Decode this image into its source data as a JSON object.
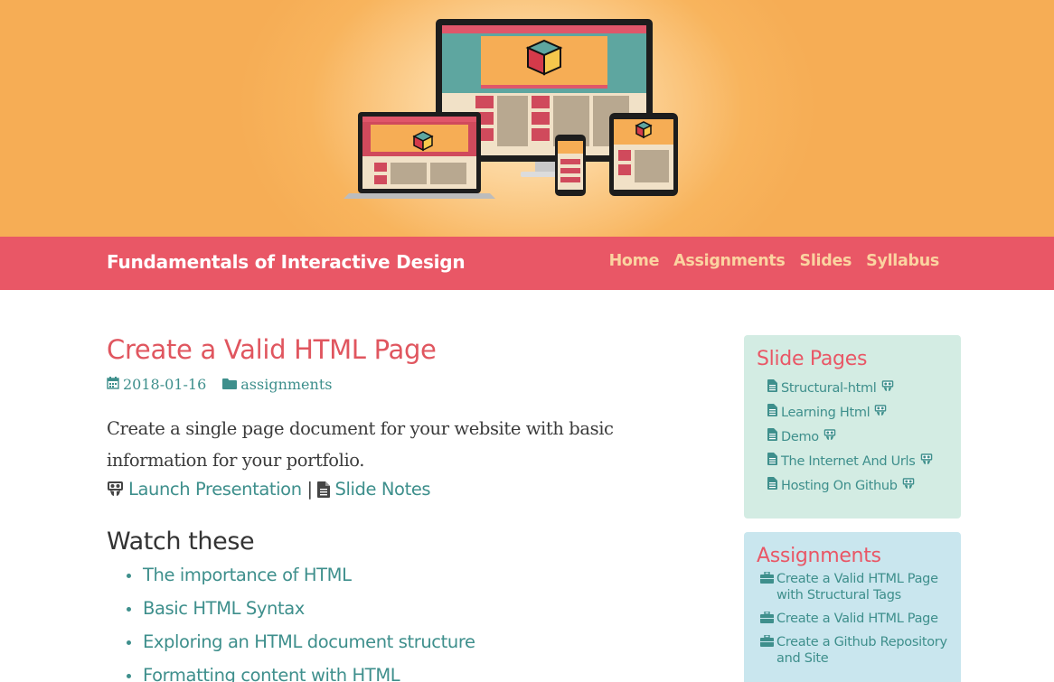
{
  "site": {
    "brand": "Fundamentals of Interactive Design",
    "nav": [
      {
        "label": "Home"
      },
      {
        "label": "Assignments"
      },
      {
        "label": "Slides"
      },
      {
        "label": "Syllabus"
      }
    ]
  },
  "post": {
    "title": "Create a Valid HTML Page",
    "date": "2018-01-16",
    "category": "assignments",
    "description": "Create a single page document for your website with basic information for your portfolio.",
    "launch_label": "Launch Presentation",
    "separator": "|",
    "notes_label": "Slide Notes",
    "watch_heading": "Watch these",
    "watch_items": [
      "The importance of HTML",
      "Basic HTML Syntax",
      "Exploring an HTML document structure",
      "Formatting content with HTML"
    ]
  },
  "sidebar": {
    "slide_pages": {
      "title": "Slide Pages",
      "items": [
        "Structural-html",
        "Learning Html",
        "Demo",
        "The Internet And Urls",
        "Hosting On Github"
      ]
    },
    "assignments": {
      "title": "Assignments",
      "items": [
        "Create a Valid HTML Page with Structural Tags",
        "Create a Valid HTML Page",
        "Create a Github Repository and Site"
      ]
    }
  },
  "colors": {
    "hero_orange": "#f6ad55",
    "navbar": "#e95766",
    "nav_link": "#fbd3a0",
    "accent_red": "#e0565f",
    "link_teal": "#3e8f8c",
    "panel_mint": "#d3ece3",
    "panel_blue": "#c9e6ee"
  },
  "icons": {
    "date": "calendar-icon",
    "category": "folder-icon",
    "presentation": "slideshare-icon",
    "notes": "file-icon",
    "assignment": "briefcase-icon"
  }
}
